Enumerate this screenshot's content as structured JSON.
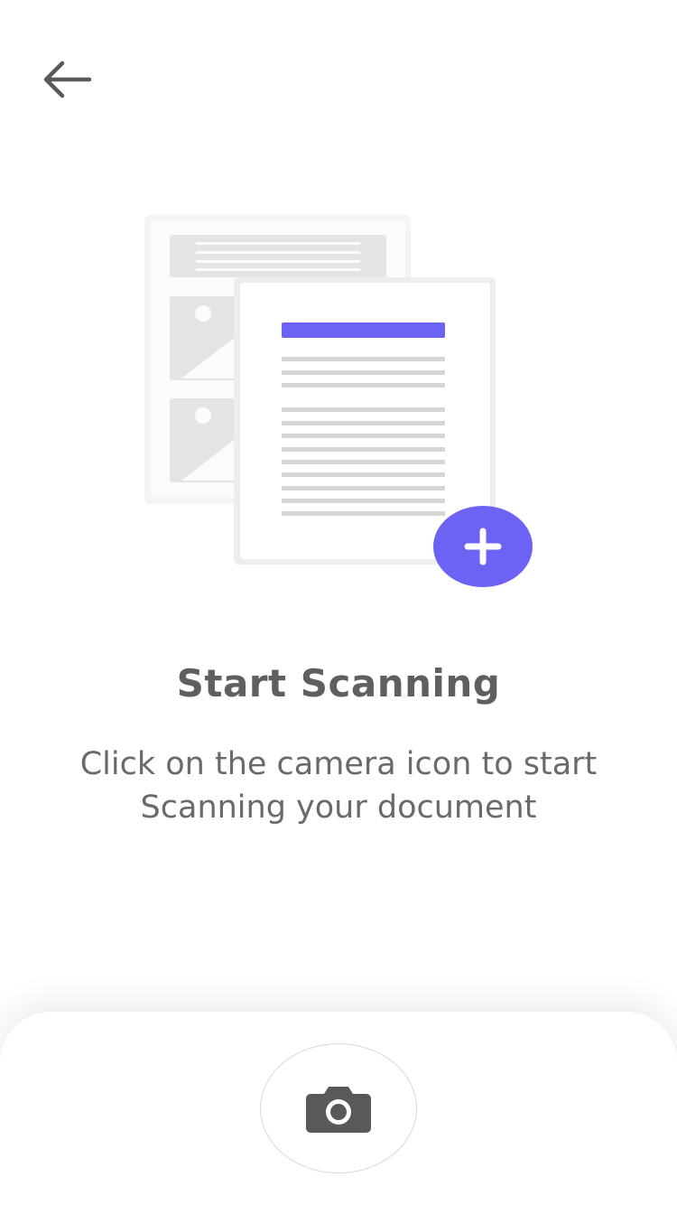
{
  "header": {
    "back_icon": "arrow-left-icon"
  },
  "illustration": {
    "icon": "documents-illustration",
    "add_icon": "plus-icon",
    "accent_color": "#6c63f5"
  },
  "empty_state": {
    "title": "Start Scanning",
    "description": "Click on the camera icon to start Scanning your document"
  },
  "bottom_bar": {
    "camera_icon": "camera-icon"
  }
}
